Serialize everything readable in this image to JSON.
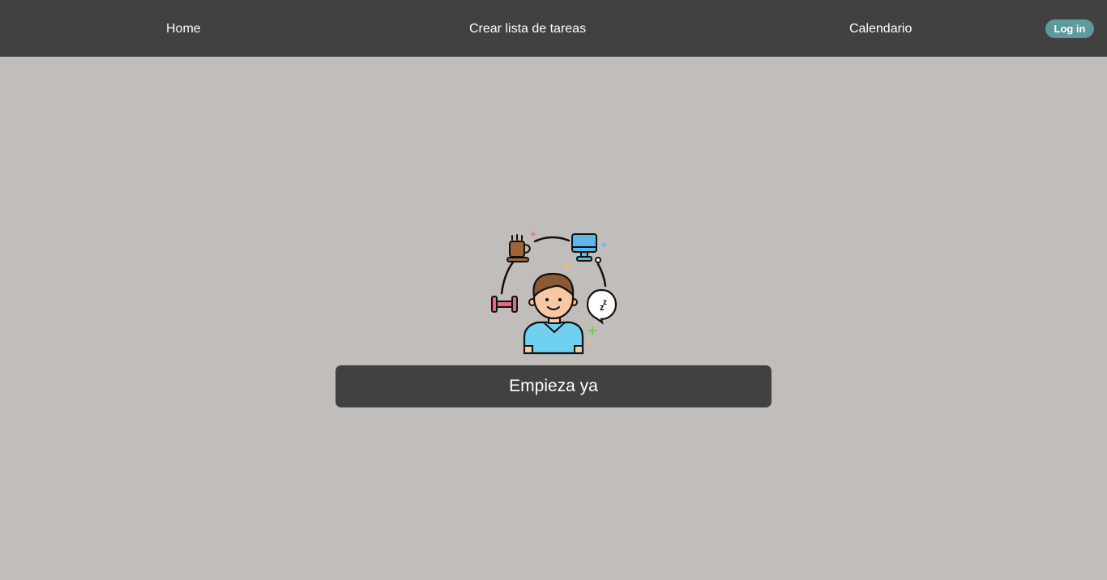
{
  "navbar": {
    "links": [
      {
        "label": "Home"
      },
      {
        "label": "Crear lista de tareas"
      },
      {
        "label": "Calendario"
      }
    ],
    "login_label": "Log in"
  },
  "hero": {
    "illustration_icons": [
      "coffee-cup-icon",
      "computer-monitor-icon",
      "dumbbell-icon",
      "sleep-bubble-icon",
      "person-avatar-icon",
      "sparkle-icon"
    ],
    "cta_label": "Empieza ya"
  },
  "colors": {
    "navbar_bg": "#414141",
    "page_bg": "#c1bdba",
    "login_accent": "#5e9a9b",
    "cta_bg": "#414141",
    "text": "#ffffff"
  }
}
